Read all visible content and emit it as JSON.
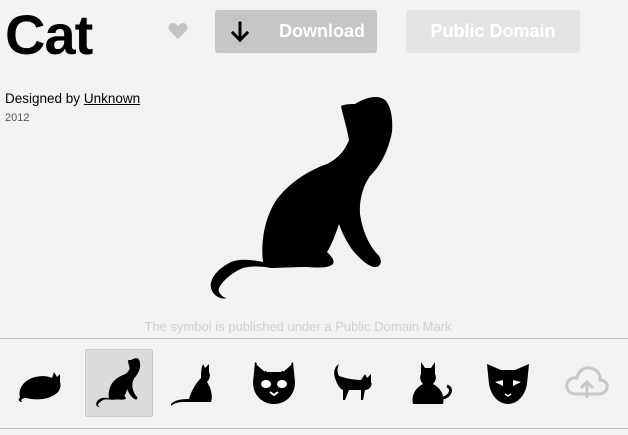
{
  "header": {
    "title": "Cat",
    "download_label": "Download",
    "license_label": "Public Domain"
  },
  "credit": {
    "designed_by": "Designed by",
    "designer": "Unknown",
    "year": "2012"
  },
  "license_note": "The symbol is published under a Public Domain Mark",
  "icons": {
    "heart": "heart-icon",
    "download": "download-arrow-icon",
    "upload": "cloud-upload-icon"
  },
  "related": [
    {
      "name": "lying cat",
      "selected": false
    },
    {
      "name": "sitting cat",
      "selected": true
    },
    {
      "name": "sitting cat",
      "selected": false
    },
    {
      "name": "cat face",
      "selected": false
    },
    {
      "name": "walking cat",
      "selected": false
    },
    {
      "name": "cat from behind",
      "selected": false
    },
    {
      "name": "cat head",
      "selected": false
    }
  ],
  "colors": {
    "background": "#f2f2f2",
    "download_button": "#c6c6c6",
    "license_button": "#e4e4e4",
    "muted_text": "#cfcfcf"
  }
}
